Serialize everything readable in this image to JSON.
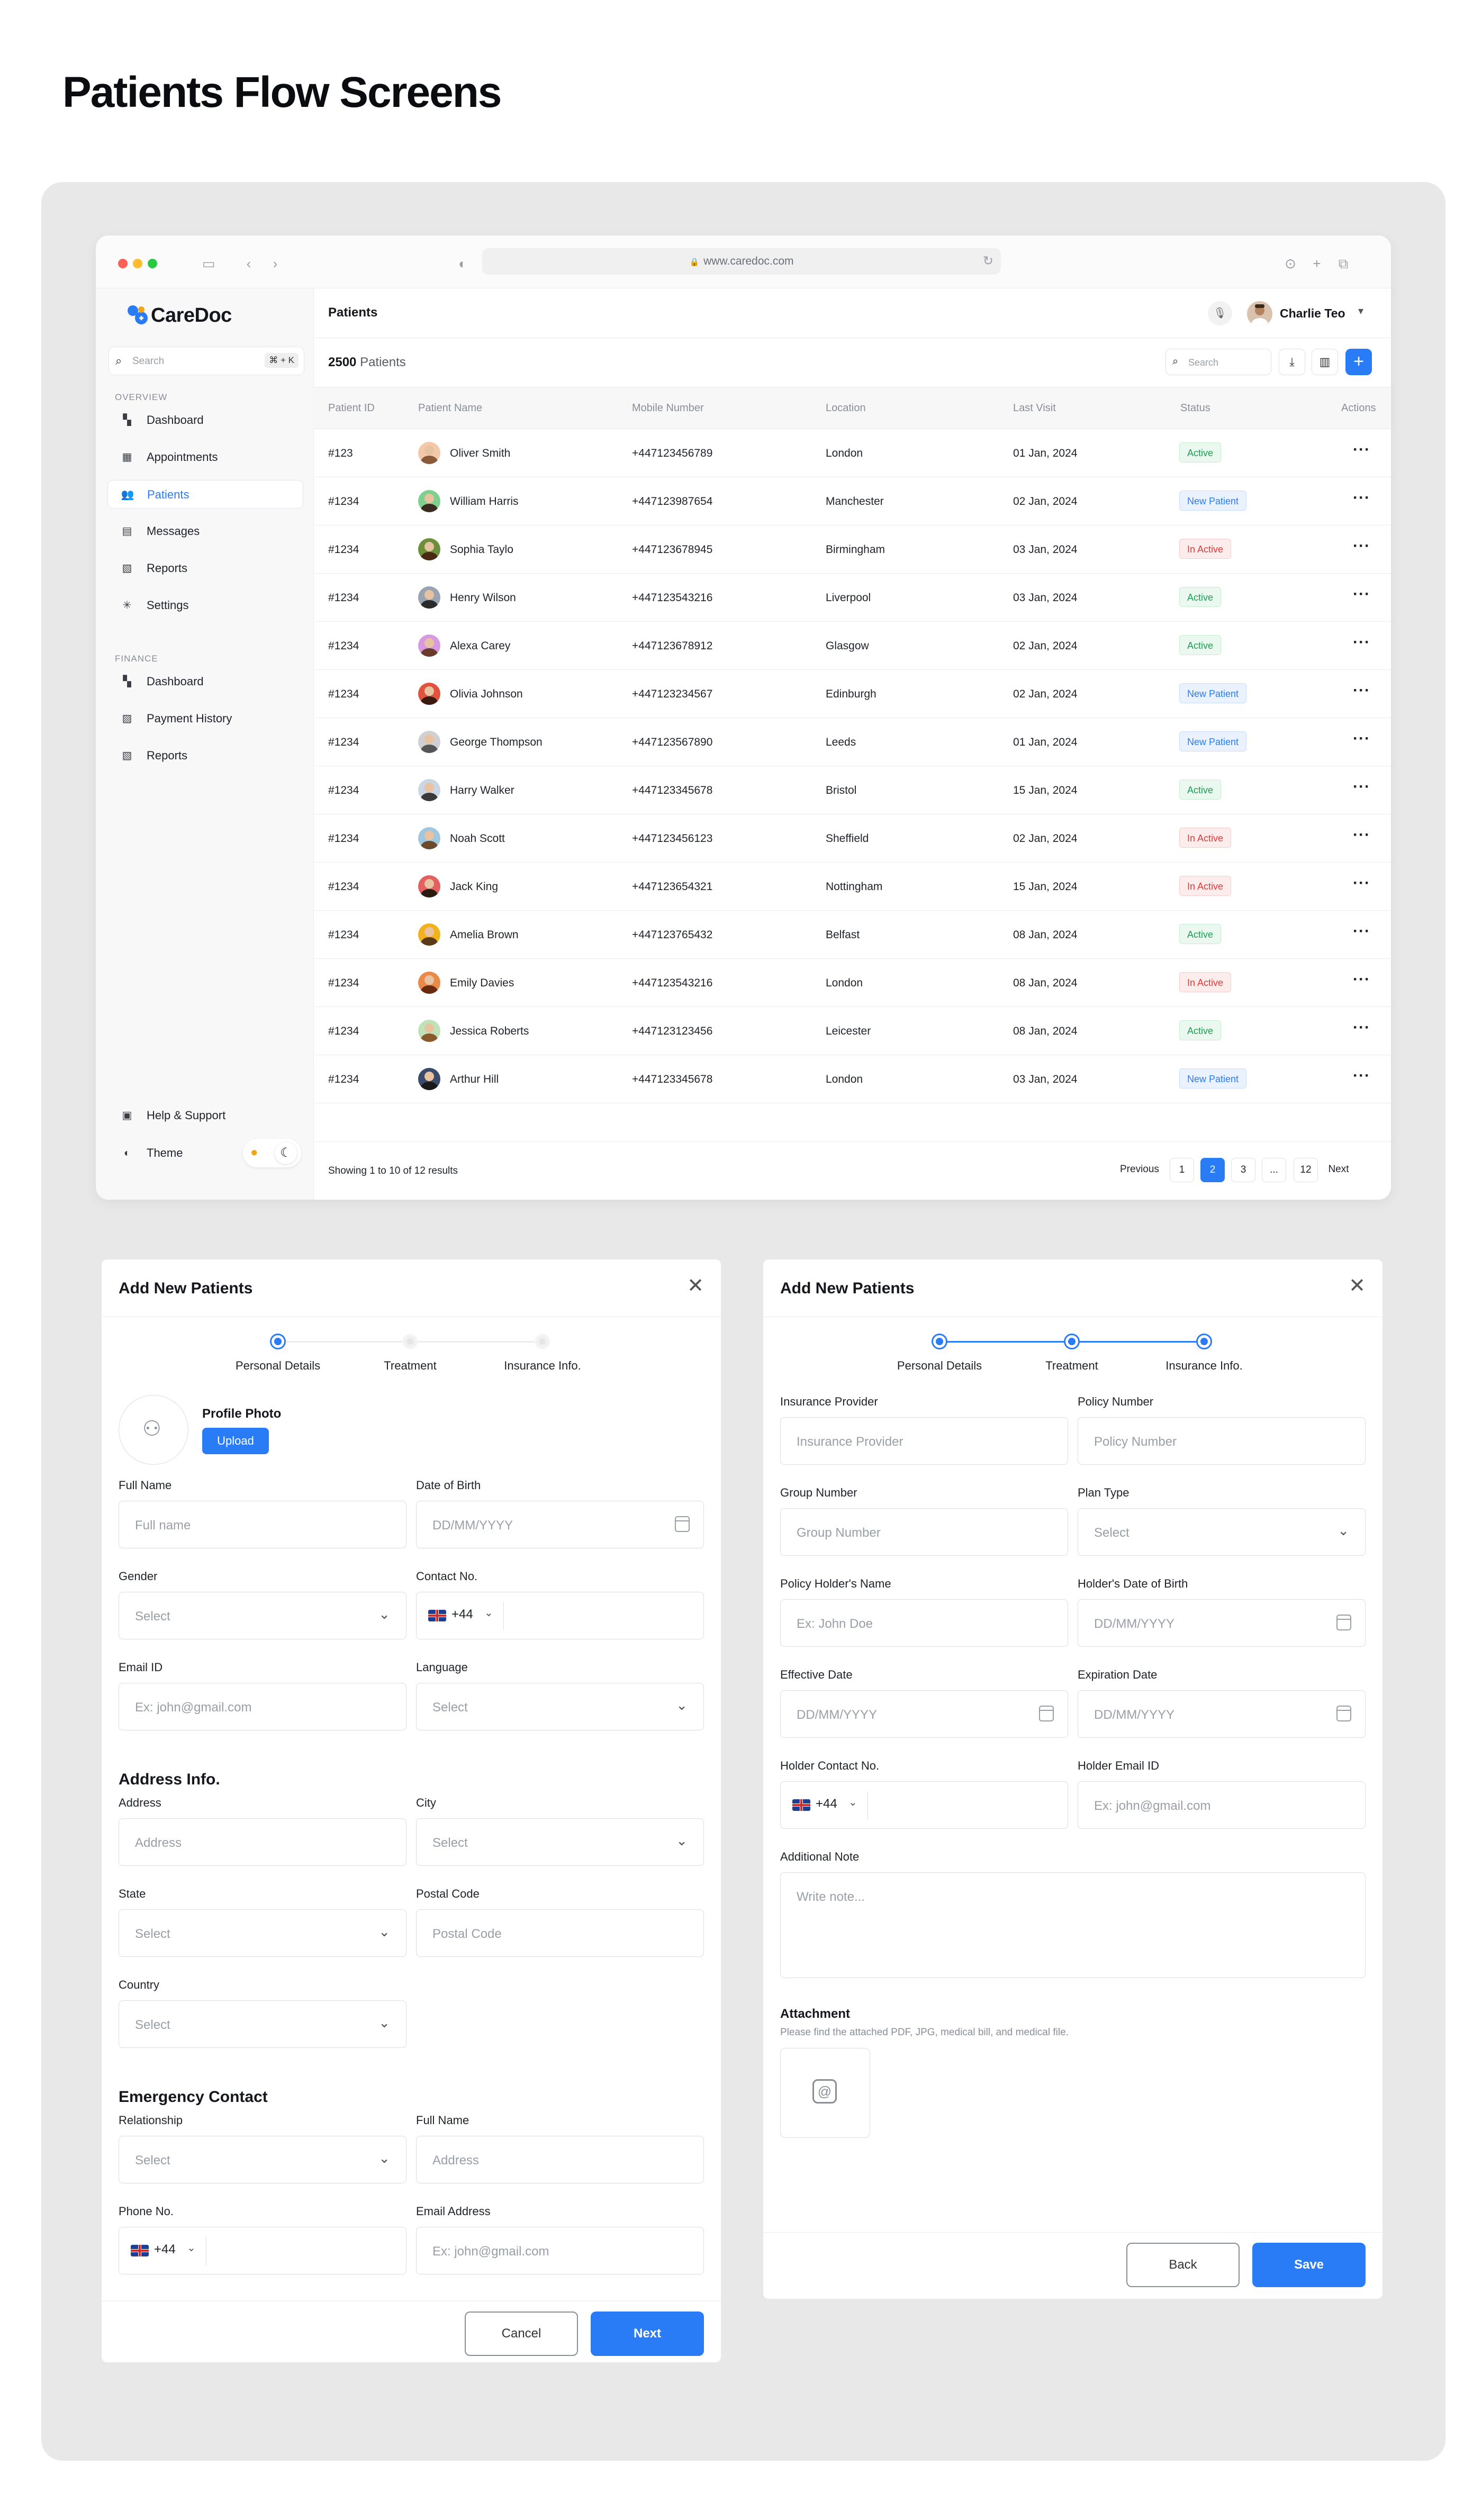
{
  "page_title": "Patients Flow Screens",
  "browser": {
    "url": "www.caredoc.com"
  },
  "sidebar": {
    "brand": "CareDoc",
    "search_placeholder": "Search",
    "search_shortcut": "⌘ + K",
    "overview_label": "OVERVIEW",
    "overview_items": [
      {
        "label": "Dashboard",
        "icon": "dashboard-icon"
      },
      {
        "label": "Appointments",
        "icon": "calendar-icon"
      },
      {
        "label": "Patients",
        "icon": "users-icon",
        "active": true
      },
      {
        "label": "Messages",
        "icon": "message-icon"
      },
      {
        "label": "Reports",
        "icon": "report-icon"
      },
      {
        "label": "Settings",
        "icon": "gear-icon"
      }
    ],
    "finance_label": "FINANCE",
    "finance_items": [
      {
        "label": "Dashboard",
        "icon": "dashboard-icon"
      },
      {
        "label": "Payment History",
        "icon": "payment-icon"
      },
      {
        "label": "Reports",
        "icon": "report-icon"
      }
    ],
    "help_label": "Help & Support",
    "theme_label": "Theme"
  },
  "header": {
    "title": "Patients",
    "user_name": "Charlie Teo"
  },
  "toolbar": {
    "count": "2500",
    "count_label": "Patients",
    "search_placeholder": "Search"
  },
  "table": {
    "columns": [
      "Patient ID",
      "Patient Name",
      "Mobile Number",
      "Location",
      "Last Visit",
      "Status",
      "Actions"
    ],
    "rows": [
      {
        "id": "#123",
        "name": "Oliver Smith",
        "mobile": "+447123456789",
        "location": "London",
        "last_visit": "01 Jan, 2024",
        "status": "Active",
        "avatar_bg": "#f3c9a9",
        "avatar_hair": "#8a5a3a"
      },
      {
        "id": "#1234",
        "name": "William Harris",
        "mobile": "+447123987654",
        "location": "Manchester",
        "last_visit": "02 Jan, 2024",
        "status": "New Patient",
        "avatar_bg": "#7fd08f",
        "avatar_hair": "#3a2a20"
      },
      {
        "id": "#1234",
        "name": "Sophia Taylo",
        "mobile": "+447123678945",
        "location": "Birmingham",
        "last_visit": "03 Jan, 2024",
        "status": "In Active",
        "avatar_bg": "#6b8f3a",
        "avatar_hair": "#4a2a15"
      },
      {
        "id": "#1234",
        "name": "Henry Wilson",
        "mobile": "+447123543216",
        "location": "Liverpool",
        "last_visit": "03 Jan, 2024",
        "status": "Active",
        "avatar_bg": "#9aa3b0",
        "avatar_hair": "#2a2a2a"
      },
      {
        "id": "#1234",
        "name": "Alexa Carey",
        "mobile": "+447123678912",
        "location": "Glasgow",
        "last_visit": "02 Jan, 2024",
        "status": "Active",
        "avatar_bg": "#d79ae0",
        "avatar_hair": "#6a3a2a"
      },
      {
        "id": "#1234",
        "name": "Olivia Johnson",
        "mobile": "+447123234567",
        "location": "Edinburgh",
        "last_visit": "02 Jan, 2024",
        "status": "New Patient",
        "avatar_bg": "#e0543f",
        "avatar_hair": "#3a1a10"
      },
      {
        "id": "#1234",
        "name": "George Thompson",
        "mobile": "+447123567890",
        "location": "Leeds",
        "last_visit": "01 Jan, 2024",
        "status": "New Patient",
        "avatar_bg": "#d0d0d4",
        "avatar_hair": "#555555"
      },
      {
        "id": "#1234",
        "name": "Harry Walker",
        "mobile": "+447123345678",
        "location": "Bristol",
        "last_visit": "15 Jan, 2024",
        "status": "Active",
        "avatar_bg": "#c9d6e4",
        "avatar_hair": "#3a3a3a"
      },
      {
        "id": "#1234",
        "name": "Noah Scott",
        "mobile": "+447123456123",
        "location": "Sheffield",
        "last_visit": "02 Jan, 2024",
        "status": "In Active",
        "avatar_bg": "#9fc7e0",
        "avatar_hair": "#6a4a2a"
      },
      {
        "id": "#1234",
        "name": "Jack King",
        "mobile": "+447123654321",
        "location": "Nottingham",
        "last_visit": "15 Jan, 2024",
        "status": "In Active",
        "avatar_bg": "#e46060",
        "avatar_hair": "#2a1a10"
      },
      {
        "id": "#1234",
        "name": "Amelia Brown",
        "mobile": "+447123765432",
        "location": "Belfast",
        "last_visit": "08 Jan, 2024",
        "status": "Active",
        "avatar_bg": "#f2b21e",
        "avatar_hair": "#5a3a1a"
      },
      {
        "id": "#1234",
        "name": "Emily Davies",
        "mobile": "+447123543216",
        "location": "London",
        "last_visit": "08 Jan, 2024",
        "status": "In Active",
        "avatar_bg": "#e9894a",
        "avatar_hair": "#6a2a10"
      },
      {
        "id": "#1234",
        "name": "Jessica Roberts",
        "mobile": "+447123123456",
        "location": "Leicester",
        "last_visit": "08 Jan, 2024",
        "status": "Active",
        "avatar_bg": "#bfe3b8",
        "avatar_hair": "#8a5a2a"
      },
      {
        "id": "#1234",
        "name": "Arthur Hill",
        "mobile": "+447123345678",
        "location": "London",
        "last_visit": "03 Jan, 2024",
        "status": "New Patient",
        "avatar_bg": "#3a4a6a",
        "avatar_hair": "#1a1a1a"
      }
    ]
  },
  "pagination": {
    "results_text": "Showing 1 to 10 of 12 results",
    "previous": "Previous",
    "next": "Next",
    "pages": [
      "1",
      "2",
      "3",
      "...",
      "12"
    ],
    "current": "2"
  },
  "modal_personal": {
    "title": "Add New Patients",
    "steps": [
      "Personal Details",
      "Treatment",
      "Insurance Info."
    ],
    "profile_photo_label": "Profile Photo",
    "upload_label": "Upload",
    "fields": {
      "full_name": {
        "label": "Full Name",
        "placeholder": "Full name"
      },
      "dob": {
        "label": "Date of Birth",
        "placeholder": "DD/MM/YYYY"
      },
      "gender": {
        "label": "Gender",
        "placeholder": "Select"
      },
      "contact": {
        "label": "Contact No.",
        "code": "+44"
      },
      "email": {
        "label": "Email ID",
        "placeholder": "Ex: john@gmail.com"
      },
      "language": {
        "label": "Language",
        "placeholder": "Select"
      }
    },
    "address_heading": "Address Info.",
    "address": {
      "address": {
        "label": "Address",
        "placeholder": "Address"
      },
      "city": {
        "label": "City",
        "placeholder": "Select"
      },
      "state": {
        "label": "State",
        "placeholder": "Select"
      },
      "postal": {
        "label": "Postal Code",
        "placeholder": "Postal Code"
      },
      "country": {
        "label": "Country",
        "placeholder": "Select"
      }
    },
    "emergency_heading": "Emergency Contact",
    "emergency": {
      "relationship": {
        "label": "Relationship",
        "placeholder": "Select"
      },
      "full_name": {
        "label": "Full Name",
        "placeholder": "Address"
      },
      "phone": {
        "label": "Phone No.",
        "code": "+44"
      },
      "email": {
        "label": "Email Address",
        "placeholder": "Ex: john@gmail.com"
      }
    },
    "cancel_label": "Cancel",
    "next_label": "Next"
  },
  "modal_insurance": {
    "title": "Add New Patients",
    "steps": [
      "Personal Details",
      "Treatment",
      "Insurance Info."
    ],
    "fields": {
      "provider": {
        "label": "Insurance Provider",
        "placeholder": "Insurance Provider"
      },
      "policy": {
        "label": "Policy Number",
        "placeholder": "Policy Number"
      },
      "group": {
        "label": "Group Number",
        "placeholder": "Group Number"
      },
      "plan": {
        "label": "Plan Type",
        "placeholder": "Select"
      },
      "holder_name": {
        "label": "Policy Holder's Name",
        "placeholder": "Ex: John Doe"
      },
      "holder_dob": {
        "label": "Holder's Date of Birth",
        "placeholder": "DD/MM/YYYY"
      },
      "effective": {
        "label": "Effective Date",
        "placeholder": "DD/MM/YYYY"
      },
      "expiration": {
        "label": "Expiration Date",
        "placeholder": "DD/MM/YYYY"
      },
      "holder_contact": {
        "label": "Holder Contact No.",
        "code": "+44"
      },
      "holder_email": {
        "label": "Holder Email ID",
        "placeholder": "Ex: john@gmail.com"
      },
      "note": {
        "label": "Additional Note",
        "placeholder": "Write note..."
      }
    },
    "attachment_title": "Attachment",
    "attachment_note": "Please find the attached PDF, JPG, medical bill, and medical file.",
    "back_label": "Back",
    "save_label": "Save"
  },
  "colors": {
    "accent": "#2a7cf6",
    "active": "#1f9d55",
    "new": "#2a7cf6",
    "inactive": "#e03a3a"
  }
}
